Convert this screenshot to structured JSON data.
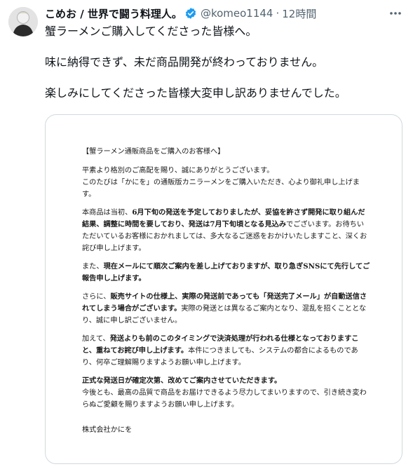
{
  "author": {
    "display_name": "こめお / 世界で闘う料理人。",
    "handle": "@komeo1144",
    "separator": "·",
    "time": "12時間"
  },
  "tweet": {
    "line1": "蟹ラーメンご購入してくださった皆様へ。",
    "line2": "味に納得できず、未だ商品開発が終わっておりません。",
    "line3": "楽しみにしてくださった皆様大変申し訳ありませんでした。"
  },
  "icons": {
    "verified": "verified-badge-icon",
    "more": "more-options-icon"
  },
  "colors": {
    "verified_blue": "#1d9bf0",
    "secondary_text": "#536471",
    "border": "#cfd9de"
  },
  "letter": {
    "heading": "【蟹ラーメン通販商品をご購入のお客様へ】",
    "p1_l1": "平素より格別のご高配を賜り、誠にありがとうございます。",
    "p1_l2": "このたびは「かにを」の通販版カニラーメンをご購入いただき、心より御礼申し上げま",
    "p1_l3": "す。",
    "p2_l1_a": "本商品は当初、",
    "p2_l1_b": "6月下旬の発送を予定しておりましたが、妥協を許さず開発に取り組んだ",
    "p2_l2_a": "結果、調整に時間を要しており、発送は7月下旬頃となる見込み",
    "p2_l2_b": "でございます。お待ちい",
    "p2_l3": "ただいているお客様におかれましては、多大なるご迷惑をおかけいたしますこと、深くお",
    "p2_l4": "詫び申し上げます。",
    "p3_l1_a": "また、",
    "p3_l1_b": "現在メールにて順次ご案内を差し上げておりますが、取り急ぎSNSにて先行してご",
    "p3_l2": "報告申し上げます。",
    "p4_l1_a": "さらに、",
    "p4_l1_b": "販売サイトの仕様上、実際の発送前であっても「発送完了メール」が自動送信さ",
    "p4_l2_a": "れてしまう場合がございます。",
    "p4_l2_b": "実際の発送とは異なるご案内となり、混乱を招くこととな",
    "p4_l3": "り、誠に申し訳ございません。",
    "p5_l1_a": "加えて、",
    "p5_l1_b": "発送よりも前のこのタイミングで決済処理が行われる仕様となっておりますこ",
    "p5_l2_a": "と、重ねてお詫び申し上げます。",
    "p5_l2_b": "本件につきましても、システムの都合によるものであ",
    "p5_l3": "り、何卒ご理解賜りますようお願い申し上げます。",
    "p6_l1": "正式な発送日が確定次第、改めてご案内させていただきます。",
    "p6_l2": "今後とも、最高の品質で商品をお届けできるよう尽力してまいりますので、引き続き変わ",
    "p6_l3": "らぬご愛顧を賜りますようお願い申し上げます。",
    "signature": "株式会社かにを"
  }
}
